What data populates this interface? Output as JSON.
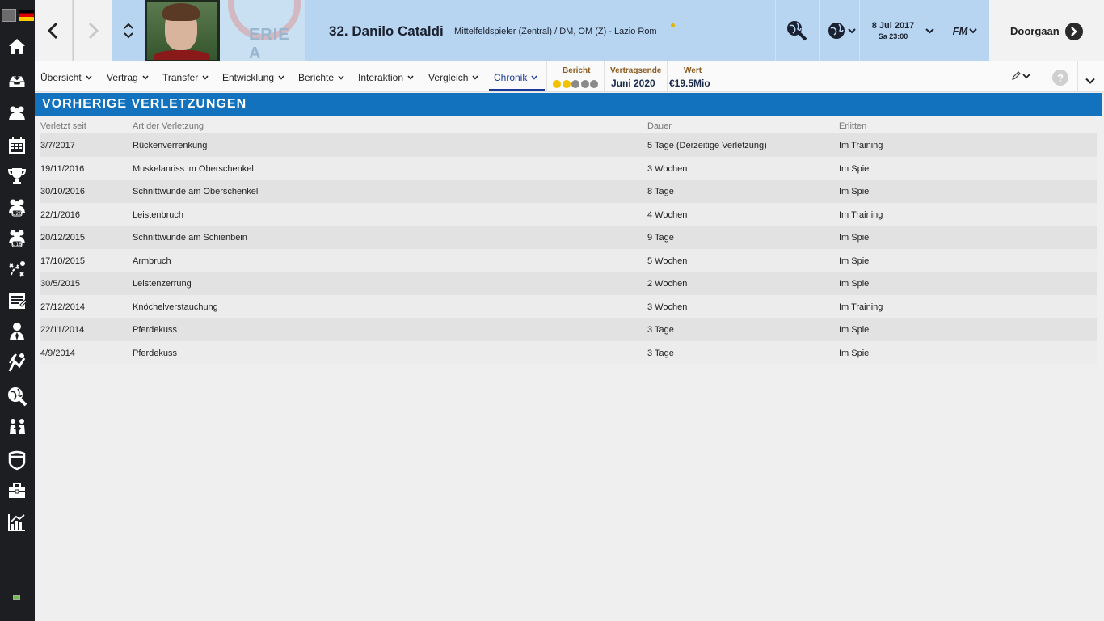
{
  "header": {
    "player_name": "32. Danilo Cataldi",
    "player_position": "Mittelfeldspieler (Zentral) / DM, OM (Z) - Lazio Rom",
    "date": "8 Jul 2017",
    "time": "Sa 23:00",
    "fm_label": "FM",
    "continue_label": "Doorgaan",
    "league_logo_text": "ERIE A"
  },
  "sidebar": {
    "icons": [
      "home-icon",
      "inbox-icon",
      "squad-icon",
      "calendar-icon",
      "trophy-icon",
      "u20-squad-icon",
      "u18-squad-icon",
      "tactics-icon",
      "reports-icon",
      "staff-icon",
      "training-icon",
      "scouting-icon",
      "transfers-icon",
      "club-icon",
      "finances-icon",
      "stats-icon"
    ]
  },
  "tabs": [
    {
      "label": "Übersicht"
    },
    {
      "label": "Vertrag"
    },
    {
      "label": "Transfer"
    },
    {
      "label": "Entwicklung"
    },
    {
      "label": "Berichte"
    },
    {
      "label": "Interaktion"
    },
    {
      "label": "Vergleich"
    },
    {
      "label": "Chronik"
    }
  ],
  "info": {
    "report_label": "Bericht",
    "report_stars": 2,
    "report_max": 5,
    "contract_label": "Vertragsende",
    "contract_value": "Juni 2020",
    "value_label": "Wert",
    "value_value": "€19.5Mio"
  },
  "panel": {
    "title": "VORHERIGE VERLETZUNGEN",
    "columns": [
      "Verletzt seit",
      "Art der Verletzung",
      "Dauer",
      "Erlitten"
    ],
    "rows": [
      [
        "3/7/2017",
        "Rückenverrenkung",
        "5 Tage (Derzeitige Verletzung)",
        "Im Training"
      ],
      [
        "19/11/2016",
        "Muskelanriss im Oberschenkel",
        "3 Wochen",
        "Im Spiel"
      ],
      [
        "30/10/2016",
        "Schnittwunde am Oberschenkel",
        "8 Tage",
        "Im Spiel"
      ],
      [
        "22/1/2016",
        "Leistenbruch",
        "4 Wochen",
        "Im Training"
      ],
      [
        "20/12/2015",
        "Schnittwunde am Schienbein",
        "9 Tage",
        "Im Spiel"
      ],
      [
        "17/10/2015",
        "Armbruch",
        "5 Wochen",
        "Im Spiel"
      ],
      [
        "30/5/2015",
        "Leistenzerrung",
        "2 Wochen",
        "Im Spiel"
      ],
      [
        "27/12/2014",
        "Knöchelverstauchung",
        "3 Wochen",
        "Im Training"
      ],
      [
        "22/11/2014",
        "Pferdekuss",
        "3 Tage",
        "Im Spiel"
      ],
      [
        "4/9/2014",
        "Pferdekuss",
        "3 Tage",
        "Im Spiel"
      ]
    ]
  },
  "colors": {
    "accent": "#1272bd",
    "header_bg": "#b7d5f0",
    "sidebar_bg": "#1d1e22",
    "star_on": "#f2c200",
    "star_off": "#8a8a8a"
  }
}
